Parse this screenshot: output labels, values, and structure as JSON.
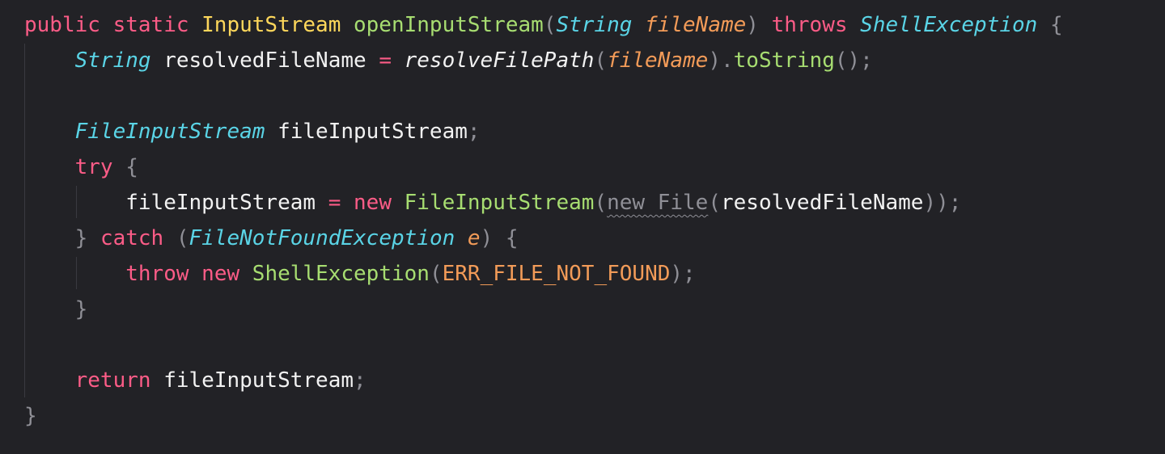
{
  "editor": {
    "language": "java",
    "colors": {
      "background": "#222226",
      "keyword": "#fc5c87",
      "type": "#fdd75b",
      "function": "#a7dd71",
      "class_ref": "#5ad4e6",
      "parameter": "#f29b58",
      "punctuation": "#8f8f96",
      "identifier": "#f2f2f2"
    },
    "lines": [
      {
        "tokens": [
          {
            "t": "public",
            "k": "kw"
          },
          {
            "t": " ",
            "k": "plain"
          },
          {
            "t": "static",
            "k": "kw"
          },
          {
            "t": " ",
            "k": "plain"
          },
          {
            "t": "InputStream",
            "k": "type"
          },
          {
            "t": " ",
            "k": "plain"
          },
          {
            "t": "openInputStream",
            "k": "fn"
          },
          {
            "t": "(",
            "k": "punc"
          },
          {
            "t": "String",
            "k": "cls"
          },
          {
            "t": " ",
            "k": "plain"
          },
          {
            "t": "fileName",
            "k": "param"
          },
          {
            "t": ")",
            "k": "punc"
          },
          {
            "t": " ",
            "k": "plain"
          },
          {
            "t": "throws",
            "k": "kw"
          },
          {
            "t": " ",
            "k": "plain"
          },
          {
            "t": "ShellException",
            "k": "cls"
          },
          {
            "t": " ",
            "k": "plain"
          },
          {
            "t": "{",
            "k": "punc"
          }
        ]
      },
      {
        "tokens": [
          {
            "t": "    ",
            "k": "plain"
          },
          {
            "t": "String",
            "k": "cls"
          },
          {
            "t": " ",
            "k": "plain"
          },
          {
            "t": "resolvedFileName",
            "k": "plain"
          },
          {
            "t": " ",
            "k": "plain"
          },
          {
            "t": "=",
            "k": "op"
          },
          {
            "t": " ",
            "k": "plain"
          },
          {
            "t": "resolveFilePath",
            "k": "static-call"
          },
          {
            "t": "(",
            "k": "punc"
          },
          {
            "t": "fileName",
            "k": "param"
          },
          {
            "t": ")",
            "k": "punc"
          },
          {
            "t": ".",
            "k": "punc"
          },
          {
            "t": "toString",
            "k": "fn"
          },
          {
            "t": "();",
            "k": "punc"
          }
        ]
      },
      {
        "tokens": []
      },
      {
        "tokens": [
          {
            "t": "    ",
            "k": "plain"
          },
          {
            "t": "FileInputStream",
            "k": "cls"
          },
          {
            "t": " ",
            "k": "plain"
          },
          {
            "t": "fileInputStream",
            "k": "plain"
          },
          {
            "t": ";",
            "k": "punc"
          }
        ]
      },
      {
        "tokens": [
          {
            "t": "    ",
            "k": "plain"
          },
          {
            "t": "try",
            "k": "kw"
          },
          {
            "t": " ",
            "k": "plain"
          },
          {
            "t": "{",
            "k": "punc"
          }
        ]
      },
      {
        "tokens": [
          {
            "t": "        ",
            "k": "plain"
          },
          {
            "t": "fileInputStream",
            "k": "plain"
          },
          {
            "t": " ",
            "k": "plain"
          },
          {
            "t": "=",
            "k": "op"
          },
          {
            "t": " ",
            "k": "plain"
          },
          {
            "t": "new",
            "k": "kw"
          },
          {
            "t": " ",
            "k": "plain"
          },
          {
            "t": "FileInputStream",
            "k": "fn"
          },
          {
            "t": "(",
            "k": "punc"
          },
          {
            "t": "new File",
            "k": "punc",
            "warn": true
          },
          {
            "t": "(",
            "k": "punc"
          },
          {
            "t": "resolvedFileName",
            "k": "plain"
          },
          {
            "t": "));",
            "k": "punc"
          }
        ]
      },
      {
        "tokens": [
          {
            "t": "    ",
            "k": "plain"
          },
          {
            "t": "}",
            "k": "punc"
          },
          {
            "t": " ",
            "k": "plain"
          },
          {
            "t": "catch",
            "k": "kw"
          },
          {
            "t": " ",
            "k": "plain"
          },
          {
            "t": "(",
            "k": "punc"
          },
          {
            "t": "FileNotFoundException",
            "k": "cls"
          },
          {
            "t": " ",
            "k": "plain"
          },
          {
            "t": "e",
            "k": "param"
          },
          {
            "t": ")",
            "k": "punc"
          },
          {
            "t": " ",
            "k": "plain"
          },
          {
            "t": "{",
            "k": "punc"
          }
        ]
      },
      {
        "tokens": [
          {
            "t": "        ",
            "k": "plain"
          },
          {
            "t": "throw",
            "k": "kw"
          },
          {
            "t": " ",
            "k": "plain"
          },
          {
            "t": "new",
            "k": "kw"
          },
          {
            "t": " ",
            "k": "plain"
          },
          {
            "t": "ShellException",
            "k": "fn"
          },
          {
            "t": "(",
            "k": "punc"
          },
          {
            "t": "ERR_FILE_NOT_FOUND",
            "k": "const"
          },
          {
            "t": ");",
            "k": "punc"
          }
        ]
      },
      {
        "tokens": [
          {
            "t": "    ",
            "k": "plain"
          },
          {
            "t": "}",
            "k": "punc"
          }
        ]
      },
      {
        "tokens": []
      },
      {
        "tokens": [
          {
            "t": "    ",
            "k": "plain"
          },
          {
            "t": "return",
            "k": "kw"
          },
          {
            "t": " ",
            "k": "plain"
          },
          {
            "t": "fileInputStream",
            "k": "plain"
          },
          {
            "t": ";",
            "k": "punc"
          }
        ]
      },
      {
        "tokens": [
          {
            "t": "}",
            "k": "punc"
          }
        ]
      }
    ]
  }
}
